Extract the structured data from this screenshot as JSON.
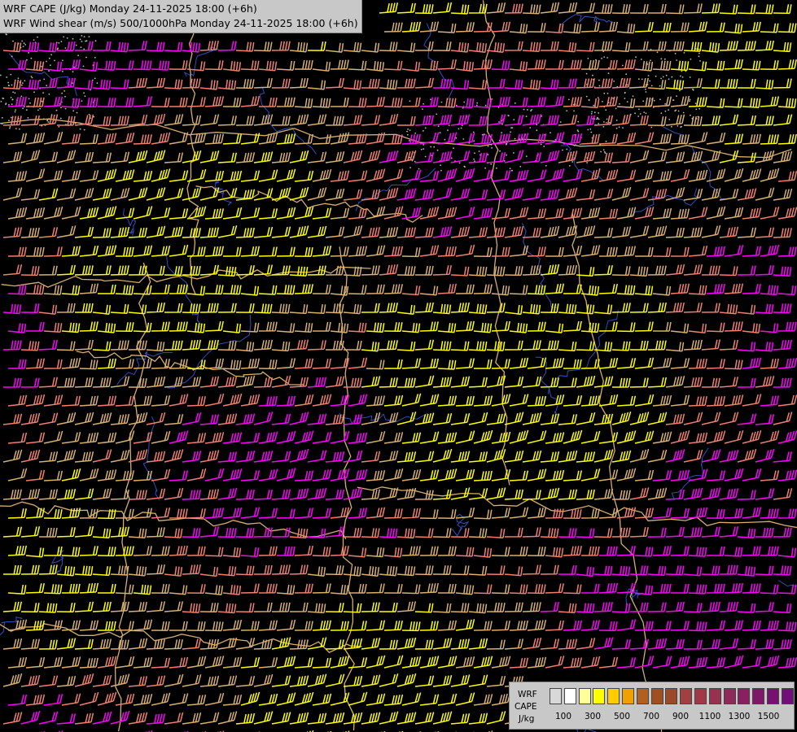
{
  "header": {
    "title_line1": "WRF CAPE (J/kg) Monday 24-11-2025 18:00 (+6h)",
    "title_line2": "WRF Wind shear (m/s) 500/1000hPa Monday 24-11-2025 18:00 (+6h)"
  },
  "legend": {
    "label_model": "WRF",
    "label_field": "CAPE",
    "label_unit": "J/kg",
    "swatch_colors": [
      "#d8d8d8",
      "#ffffff",
      "#ffff99",
      "#ffff00",
      "#ffcc00",
      "#f0a000",
      "#b06020",
      "#a05020",
      "#9a4a2a",
      "#a04040",
      "#a03848",
      "#983050",
      "#902a58",
      "#8a2060",
      "#801868",
      "#781070",
      "#701078"
    ],
    "tick_labels": [
      "100",
      "300",
      "500",
      "700",
      "900",
      "1100",
      "1300",
      "1500"
    ]
  },
  "colors": {
    "background": "#000000",
    "barb_yellow": "#ffff00",
    "barb_tan": "#d8b070",
    "barb_salmon": "#f08070",
    "barb_magenta": "#ff00ff",
    "border_line": "#d8b070",
    "river_line": "#3050c0"
  }
}
